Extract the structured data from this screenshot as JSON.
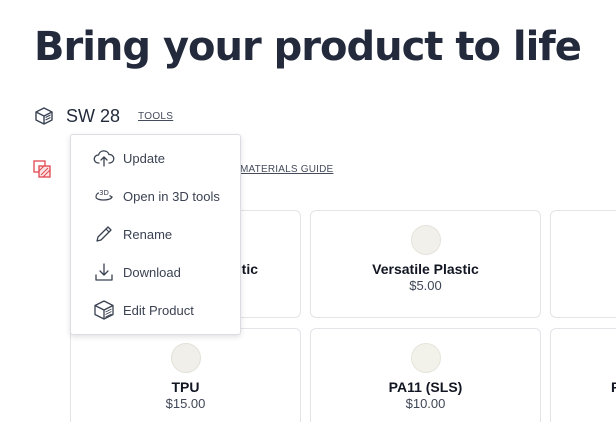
{
  "page": {
    "title": "Bring your product to life"
  },
  "product": {
    "name": "SW 28",
    "tools_label": "TOOLS"
  },
  "materials": {
    "guide_label": "MATERIALS GUIDE"
  },
  "menu": {
    "items": [
      {
        "label": "Update",
        "icon": "cloud-upload-icon"
      },
      {
        "label": "Open in 3D tools",
        "icon": "3d-rotate-icon"
      },
      {
        "label": "Rename",
        "icon": "pencil-icon"
      },
      {
        "label": "Download",
        "icon": "download-icon"
      },
      {
        "label": "Edit Product",
        "icon": "cube-icon"
      }
    ]
  },
  "cards": [
    {
      "name": "tic",
      "price": "",
      "swatch": "#f4f3ee"
    },
    {
      "name": "Versatile Plastic",
      "price": "$5.00",
      "swatch": "#f1f0ea"
    },
    {
      "name": "",
      "price": "",
      "swatch": ""
    },
    {
      "name": "TPU",
      "price": "$15.00",
      "swatch": "#f0efe9"
    },
    {
      "name": "PA11 (SLS)",
      "price": "$10.00",
      "swatch": "#f3f2ea"
    },
    {
      "name": "F",
      "price": "",
      "swatch": ""
    }
  ],
  "colors": {
    "title": "#232a3c",
    "card_border": "#e3e4e8",
    "accent_red": "#e0464e"
  }
}
